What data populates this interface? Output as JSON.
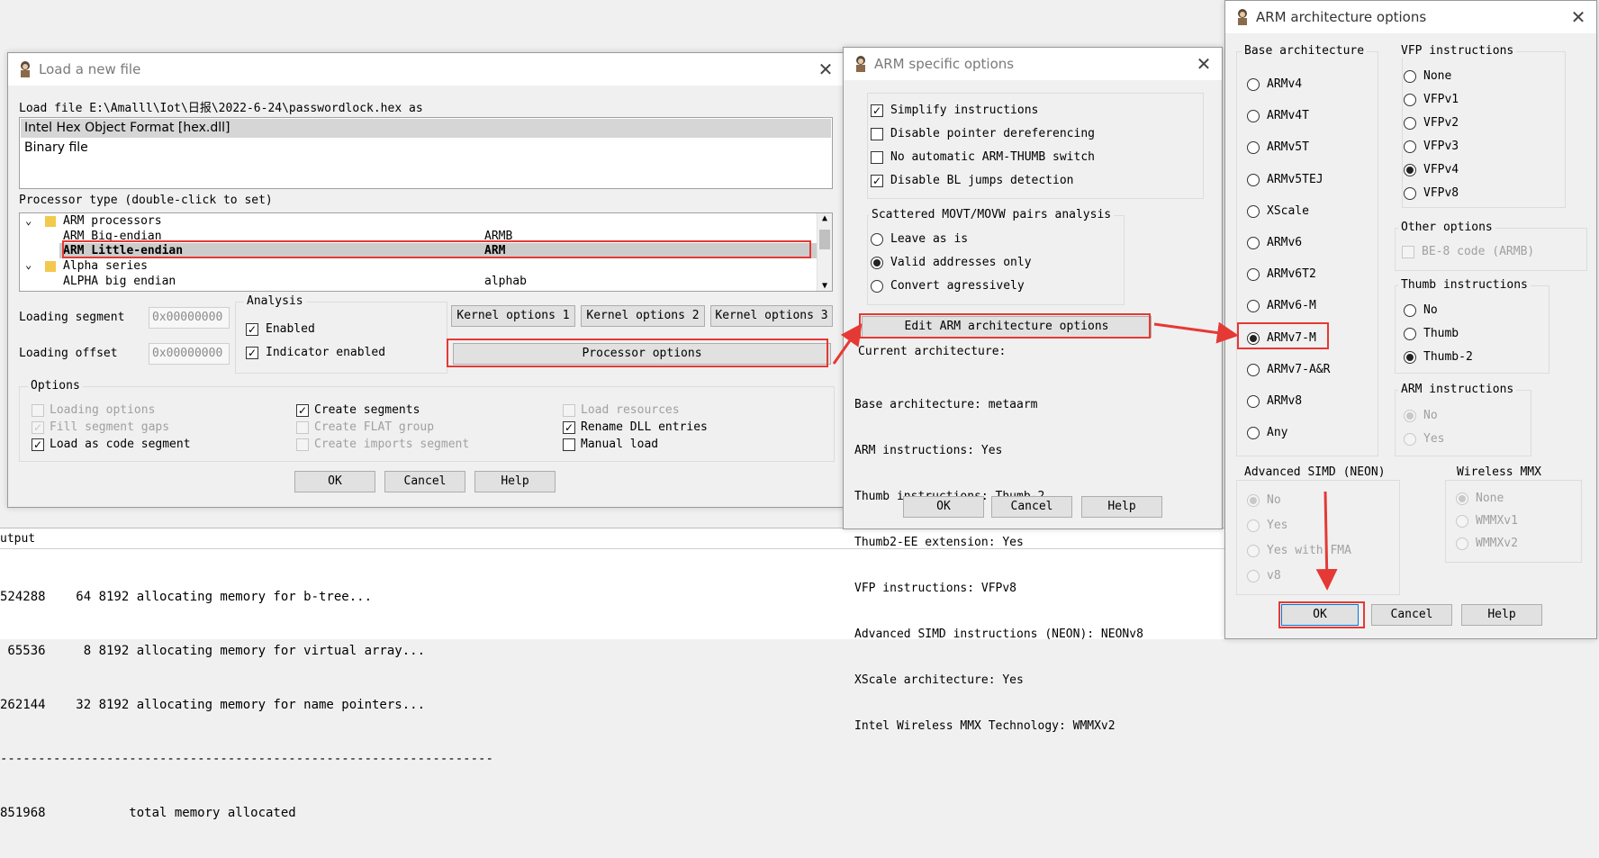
{
  "load_dialog": {
    "title": "Load a new file",
    "load_file_line": "Load file E:\\Amalll\\Iot\\日报\\2022-6-24\\passwordlock.hex as",
    "formats": [
      "Intel Hex Object Format [hex.dll]",
      "Binary file"
    ],
    "processor_type_label": "Processor type (double-click to set)",
    "processor_tree": [
      {
        "kind": "group",
        "name": "ARM processors",
        "code": ""
      },
      {
        "kind": "item",
        "name": "ARM Big-endian",
        "code": "ARMB"
      },
      {
        "kind": "item",
        "name": "ARM Little-endian",
        "code": "ARM",
        "selected": true
      },
      {
        "kind": "group",
        "name": "Alpha series",
        "code": ""
      },
      {
        "kind": "item",
        "name": "ALPHA big endian",
        "code": "alphab"
      }
    ],
    "loading_segment_label": "Loading segment",
    "loading_segment_value": "0x00000000",
    "loading_offset_label": "Loading offset",
    "loading_offset_value": "0x00000000",
    "analysis_title": "Analysis",
    "enabled_label": "Enabled",
    "indicator_label": "Indicator enabled",
    "kernel1": "Kernel options 1",
    "kernel2": "Kernel options 2",
    "kernel3": "Kernel options 3",
    "processor_options": "Processor options",
    "options_title": "Options",
    "options": [
      {
        "label": "Loading options",
        "checked": false,
        "disabled": true
      },
      {
        "label": "Fill segment gaps",
        "checked": true,
        "disabled": true
      },
      {
        "label": "Load as code segment",
        "checked": true,
        "disabled": false
      },
      {
        "label": "Create segments",
        "checked": true,
        "disabled": false
      },
      {
        "label": "Create FLAT group",
        "checked": false,
        "disabled": true
      },
      {
        "label": "Create imports segment",
        "checked": false,
        "disabled": true
      },
      {
        "label": "Load resources",
        "checked": false,
        "disabled": true
      },
      {
        "label": "Rename DLL entries",
        "checked": true,
        "disabled": false
      },
      {
        "label": "Manual load",
        "checked": false,
        "disabled": false
      }
    ],
    "ok": "OK",
    "cancel": "Cancel",
    "help": "Help"
  },
  "arm_specific": {
    "title": "ARM specific options",
    "checks": [
      {
        "label": "Simplify instructions",
        "checked": true
      },
      {
        "label": "Disable pointer dereferencing",
        "checked": false
      },
      {
        "label": "No automatic ARM-THUMB switch",
        "checked": false
      },
      {
        "label": "Disable BL jumps detection",
        "checked": true
      }
    ],
    "movt_title": "Scattered MOVT/MOVW pairs analysis",
    "movt_options": [
      {
        "label": "Leave as is",
        "selected": false
      },
      {
        "label": "Valid addresses only",
        "selected": true
      },
      {
        "label": "Convert agressively",
        "selected": false
      }
    ],
    "edit_button": "Edit ARM architecture options",
    "current_arch_label": "Current architecture:",
    "current_arch_lines": [
      "Base architecture: metaarm",
      "ARM instructions: Yes",
      "Thumb instructions: Thumb-2",
      "Thumb2-EE extension: Yes",
      "VFP instructions: VFPv8",
      "Advanced SIMD instructions (NEON): NEONv8",
      "XScale architecture: Yes",
      "Intel Wireless MMX Technology: WMMXv2"
    ],
    "ok": "OK",
    "cancel": "Cancel",
    "help": "Help"
  },
  "arch_options": {
    "title": "ARM architecture options",
    "base_title": "Base architecture",
    "base": [
      {
        "label": "ARMv4",
        "selected": false
      },
      {
        "label": "ARMv4T",
        "selected": false
      },
      {
        "label": "ARMv5T",
        "selected": false
      },
      {
        "label": "ARMv5TEJ",
        "selected": false
      },
      {
        "label": "XScale",
        "selected": false
      },
      {
        "label": "ARMv6",
        "selected": false
      },
      {
        "label": "ARMv6T2",
        "selected": false
      },
      {
        "label": "ARMv6-M",
        "selected": false
      },
      {
        "label": "ARMv7-M",
        "selected": true
      },
      {
        "label": "ARMv7-A&R",
        "selected": false
      },
      {
        "label": "ARMv8",
        "selected": false
      },
      {
        "label": "Any",
        "selected": false
      }
    ],
    "vfp_title": "VFP instructions",
    "vfp": [
      {
        "label": "None",
        "selected": false
      },
      {
        "label": "VFPv1",
        "selected": false
      },
      {
        "label": "VFPv2",
        "selected": false
      },
      {
        "label": "VFPv3",
        "selected": false
      },
      {
        "label": "VFPv4",
        "selected": true
      },
      {
        "label": "VFPv8",
        "selected": false
      }
    ],
    "other_title": "Other options",
    "be8": "BE-8 code (ARMB)",
    "thumb_title": "Thumb instructions",
    "thumb": [
      {
        "label": "No",
        "selected": false
      },
      {
        "label": "Thumb",
        "selected": false
      },
      {
        "label": "Thumb-2",
        "selected": true
      }
    ],
    "armins_title": "ARM instructions",
    "armins": [
      {
        "label": "No",
        "selected": true
      },
      {
        "label": "Yes",
        "selected": false
      }
    ],
    "simd_title": "Advanced SIMD (NEON)",
    "simd": [
      {
        "label": "No",
        "selected": true
      },
      {
        "label": "Yes",
        "selected": false
      },
      {
        "label": "Yes with FMA",
        "selected": false
      },
      {
        "label": "v8",
        "selected": false
      }
    ],
    "wmmx_title": "Wireless MMX",
    "wmmx": [
      {
        "label": "None",
        "selected": true
      },
      {
        "label": "WMMXv1",
        "selected": false
      },
      {
        "label": "WMMXv2",
        "selected": false
      }
    ],
    "ok": "OK",
    "cancel": "Cancel",
    "help": "Help"
  },
  "output": {
    "title": "utput",
    "lines": [
      "524288    64 8192 allocating memory for b-tree...",
      " 65536     8 8192 allocating memory for virtual array...",
      "262144    32 8192 allocating memory for name pointers...",
      "-----------------------------------------------------------------",
      "851968           total memory allocated"
    ]
  },
  "colors": {
    "highlight_red": "#e53935",
    "selection_gray": "#cccccc"
  }
}
